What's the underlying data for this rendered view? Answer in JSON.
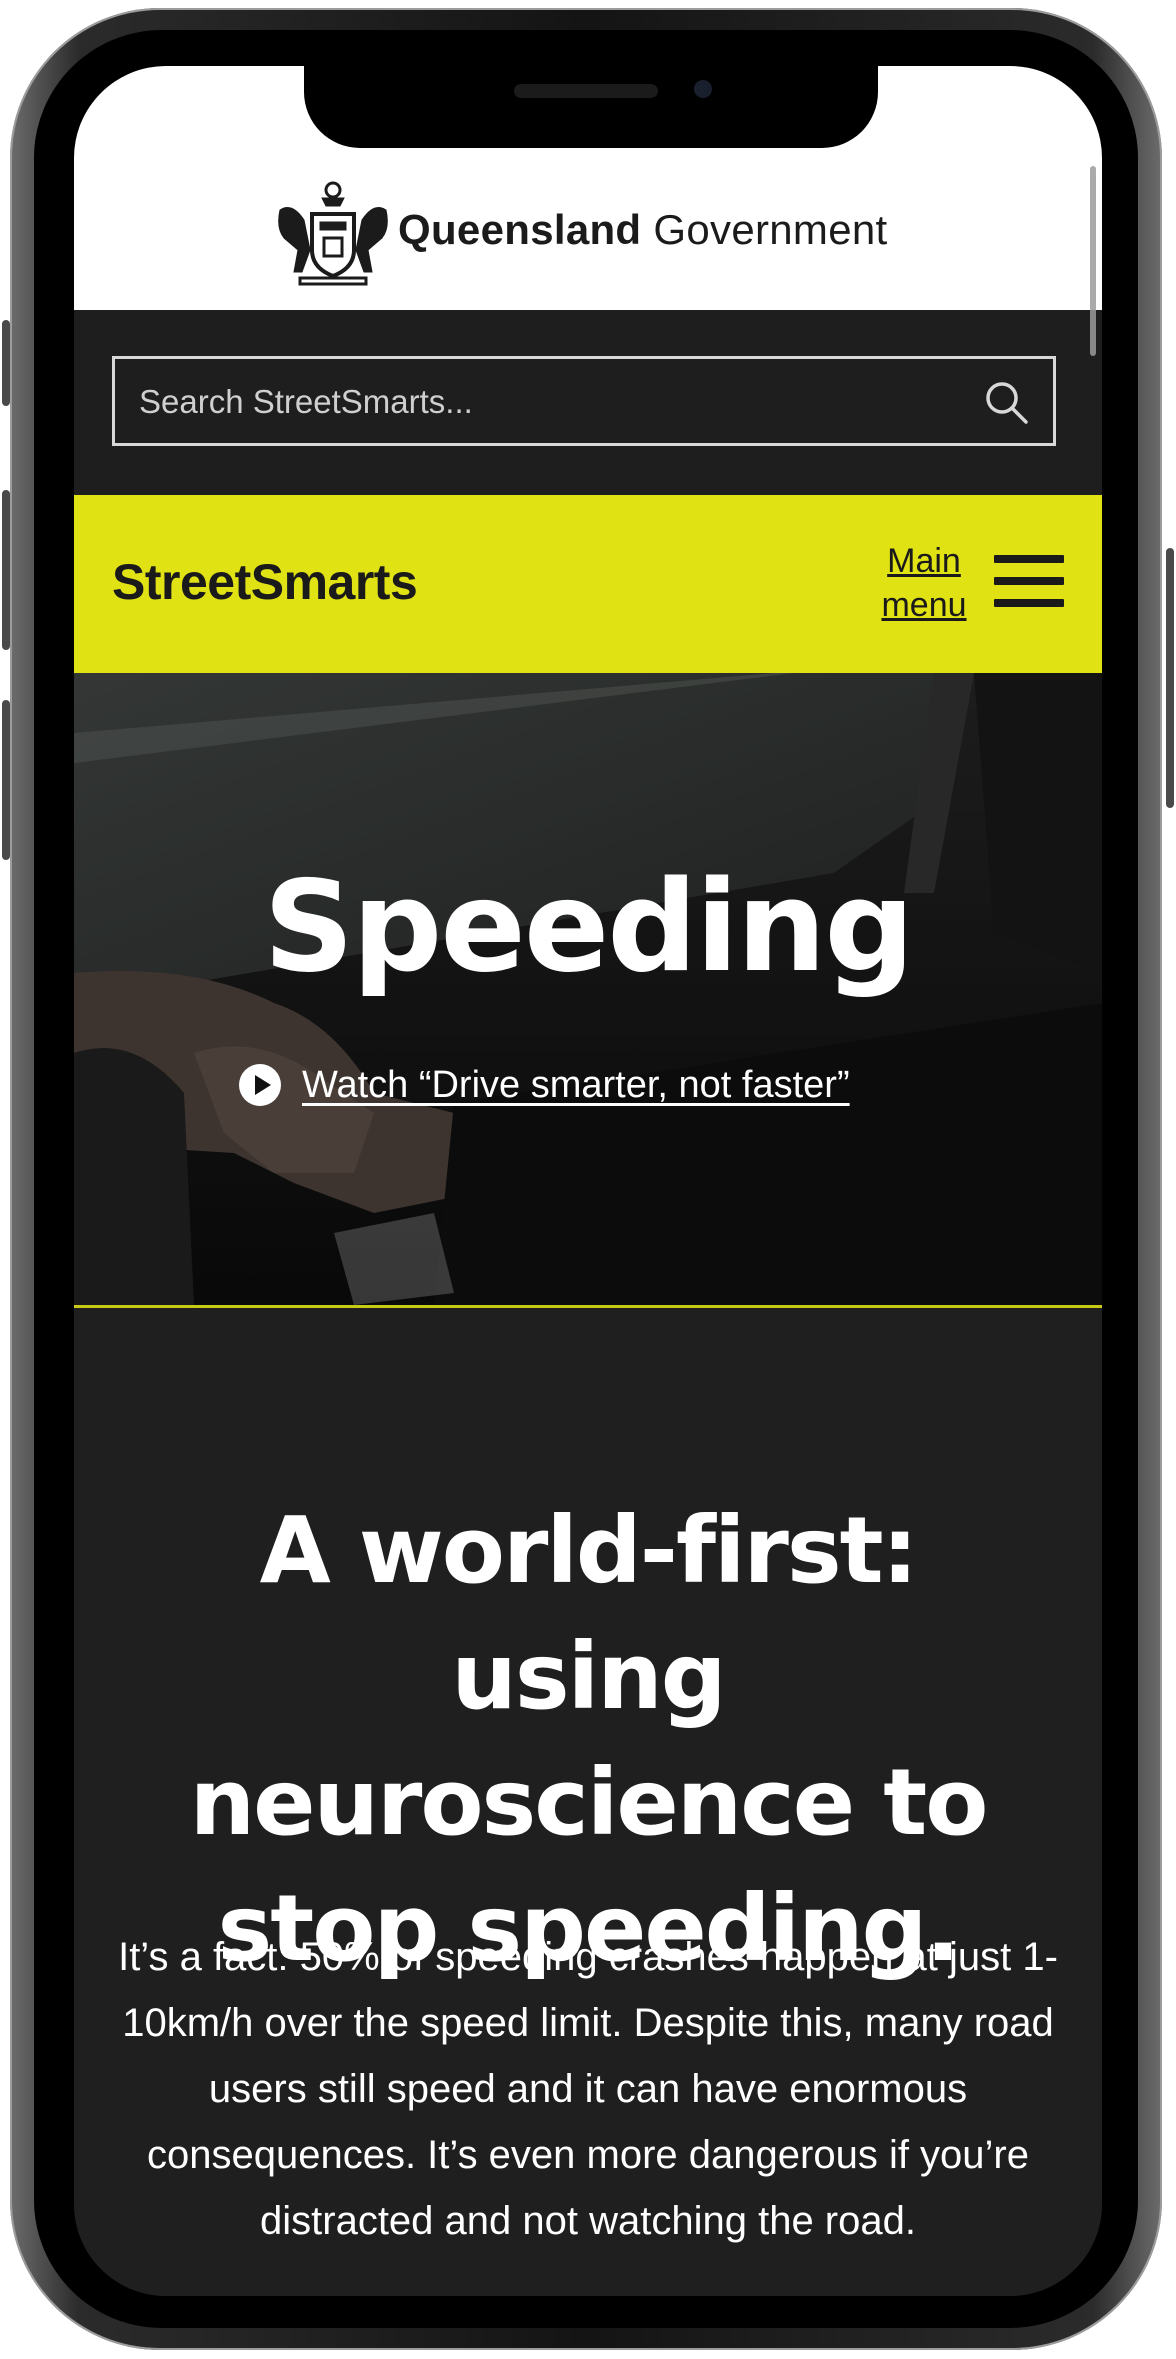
{
  "gov": {
    "name_bold": "Queensland",
    "name_regular": "Government"
  },
  "search": {
    "placeholder": "Search StreetSmarts..."
  },
  "nav": {
    "brand": "StreetSmarts",
    "menu_line1": "Main",
    "menu_line2": "menu"
  },
  "hero": {
    "title": "Speeding",
    "video_link": "Watch “Drive smarter, not faster”"
  },
  "content": {
    "headline_line1": "A world-first: using",
    "headline_line2": "neuroscience to",
    "headline_line3": "stop speeding.",
    "body": "It’s a fact: 50% of speeding crashes happen at just 1-10km/h over the speed limit. Despite this, many road users still speed and it can have enormous consequences. It’s even more dangerous if you’re distracted and not watching the road."
  },
  "colors": {
    "accent_yellow": "#e0e214",
    "dark_bg": "#1f1f1f",
    "text_white": "#ffffff"
  },
  "icons": {
    "crest": "queensland-crest-icon",
    "search": "search-icon",
    "menu": "hamburger-menu-icon",
    "play": "play-icon"
  }
}
